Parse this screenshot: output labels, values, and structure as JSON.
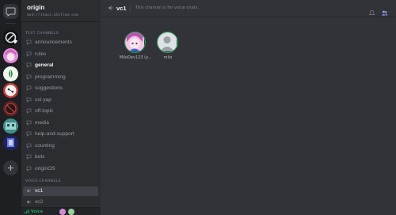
{
  "guild": {
    "name": "origin",
    "url": "mod://ihaos.ahstlom.com"
  },
  "sections": {
    "text": "TEXT CHANNELS",
    "voice": "VOICE CHANNELS"
  },
  "text_channels": [
    {
      "label": "announcements"
    },
    {
      "label": "rules"
    },
    {
      "label": "general"
    },
    {
      "label": "programming"
    },
    {
      "label": "suggestions"
    },
    {
      "label": "osl yap"
    },
    {
      "label": "off-topic"
    },
    {
      "label": "media"
    },
    {
      "label": "help-and-support"
    },
    {
      "label": "counting"
    },
    {
      "label": "bots"
    },
    {
      "label": "originOS"
    }
  ],
  "voice_channels": [
    {
      "label": "vc1"
    },
    {
      "label": "vc2"
    }
  ],
  "voice_bar": {
    "status": "Voice"
  },
  "topbar": {
    "channel": "vc1",
    "topic": "This channel is for voice chats."
  },
  "participants": [
    {
      "name": "MiloDev123 (y...",
      "avatar": "anime-avatar"
    },
    {
      "name": "milo",
      "avatar": "default-avatar"
    }
  ],
  "colors": {
    "accent": "#5865f2",
    "speaking": "#23a55a",
    "background": "#313338",
    "sidebar": "#2b2d31"
  }
}
